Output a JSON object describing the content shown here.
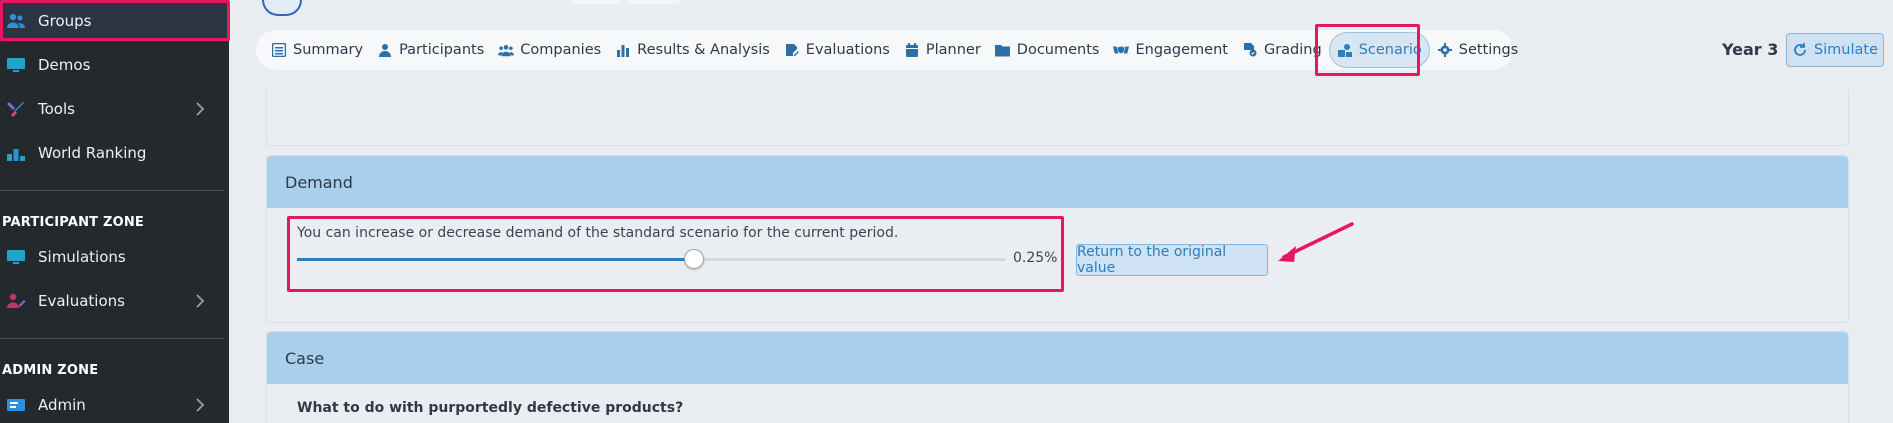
{
  "sidebar": {
    "items": [
      {
        "label": "Groups",
        "icon": "users-icon"
      },
      {
        "label": "Demos",
        "icon": "monitor-icon"
      },
      {
        "label": "Tools",
        "icon": "tools-icon"
      },
      {
        "label": "World Ranking",
        "icon": "podium-icon"
      },
      {
        "label": "Simulations",
        "icon": "monitor-icon"
      },
      {
        "label": "Evaluations",
        "icon": "user-edit-icon"
      },
      {
        "label": "Admin",
        "icon": "admin-icon"
      }
    ],
    "sections": {
      "participant_zone": "PARTICIPANT ZONE",
      "admin_zone": "ADMIN ZONE"
    }
  },
  "tabs": [
    {
      "label": "Summary",
      "icon": "list-icon"
    },
    {
      "label": "Participants",
      "icon": "user-icon"
    },
    {
      "label": "Companies",
      "icon": "users-icon"
    },
    {
      "label": "Results & Analysis",
      "icon": "bar-chart-icon"
    },
    {
      "label": "Evaluations",
      "icon": "edit-icon"
    },
    {
      "label": "Planner",
      "icon": "calendar-icon"
    },
    {
      "label": "Documents",
      "icon": "folder-icon"
    },
    {
      "label": "Engagement",
      "icon": "handshake-icon"
    },
    {
      "label": "Grading",
      "icon": "grading-icon"
    },
    {
      "label": "Scenario",
      "icon": "scenario-icon"
    },
    {
      "label": "Settings",
      "icon": "gear-icon"
    }
  ],
  "active_tab": "Scenario",
  "header": {
    "year": "Year 3",
    "simulate_label": "Simulate"
  },
  "demand": {
    "title": "Demand",
    "description": "You can increase or decrease demand of the standard scenario for the current period.",
    "slider_fraction": 0.56,
    "value_text": "0.25%",
    "return_label": "Return to the original value"
  },
  "case": {
    "title": "Case",
    "question": "What to do with purportedly defective products?"
  },
  "colors": {
    "accent": "#2a7fbd",
    "highlight": "#e8175d",
    "sidebar_bg": "#24292e",
    "card_header": "#a8cfec"
  }
}
